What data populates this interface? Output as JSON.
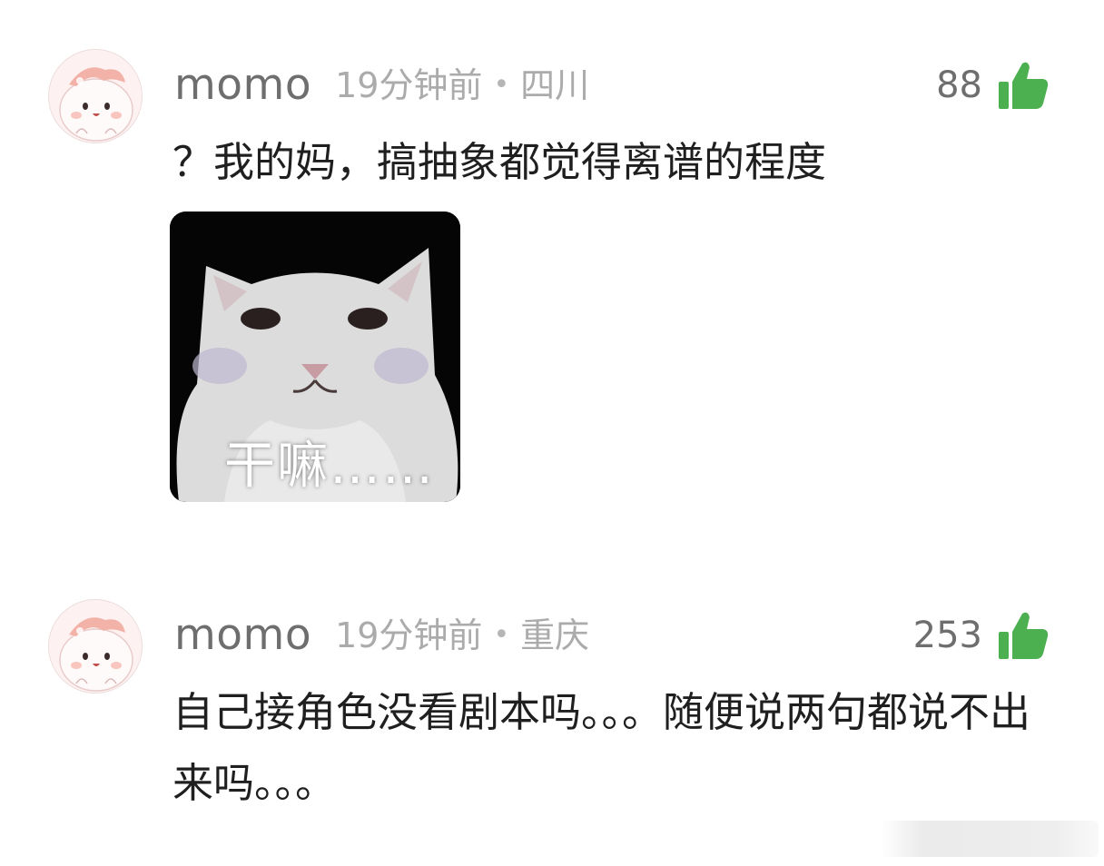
{
  "comments": [
    {
      "username": "momo",
      "time": "19分钟前",
      "separator": "•",
      "location": "四川",
      "likes": "88",
      "text": "？我的妈，搞抽象都觉得离谱的程度",
      "sticker": {
        "caption": "干嘛……"
      }
    },
    {
      "username": "momo",
      "time": "19分钟前",
      "separator": "•",
      "location": "重庆",
      "likes": "253",
      "text": "自己接角色没看剧本吗。。。随便说两句都说不出来吗。。。"
    }
  ],
  "colors": {
    "like_icon": "#4caf50",
    "username": "#6e6e6e",
    "meta": "#ababab",
    "text": "#1f1f1f"
  },
  "icons": {
    "like": "thumbs-up-icon",
    "avatar": "cartoon-avatar"
  }
}
